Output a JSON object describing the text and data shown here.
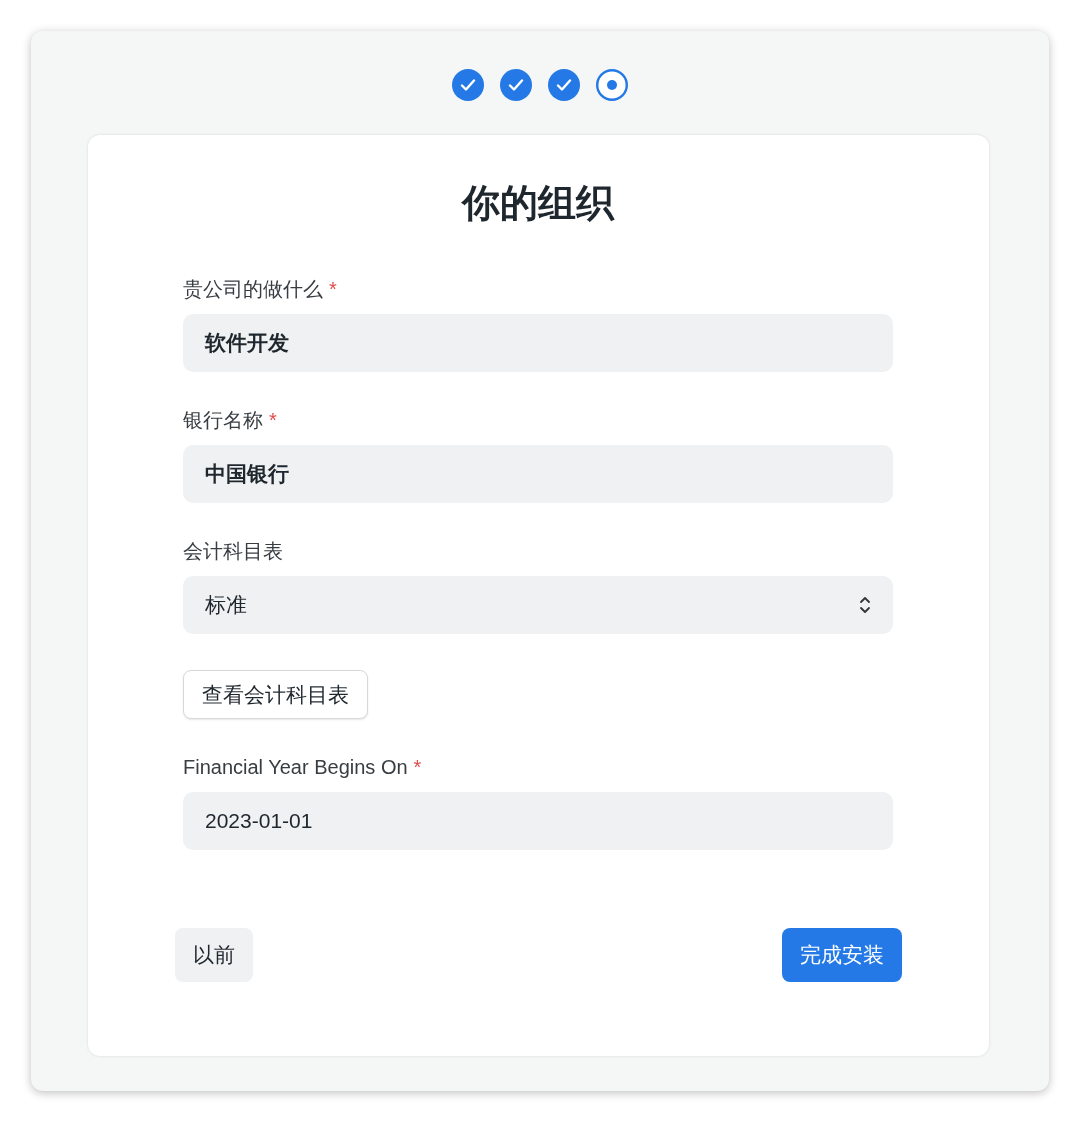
{
  "steps": [
    {
      "completed": true,
      "selected": false
    },
    {
      "completed": true,
      "selected": false
    },
    {
      "completed": true,
      "selected": false
    },
    {
      "completed": false,
      "selected": true
    }
  ],
  "title": "你的组织",
  "fields": [
    {
      "kind": "text",
      "label": "贵公司的做什么",
      "required_mark": "*",
      "value": "软件开发"
    },
    {
      "kind": "text",
      "label": "银行名称",
      "required_mark": "*",
      "value": "中国银行"
    },
    {
      "kind": "select",
      "label": "会计科目表",
      "value": "标准"
    },
    {
      "kind": "button",
      "text": "查看会计科目表"
    },
    {
      "kind": "date",
      "label": "Financial Year Begins On",
      "required_mark": "*",
      "value": "2023-01-01"
    }
  ],
  "buttons": {
    "back": "以前",
    "finish": "完成安装"
  }
}
